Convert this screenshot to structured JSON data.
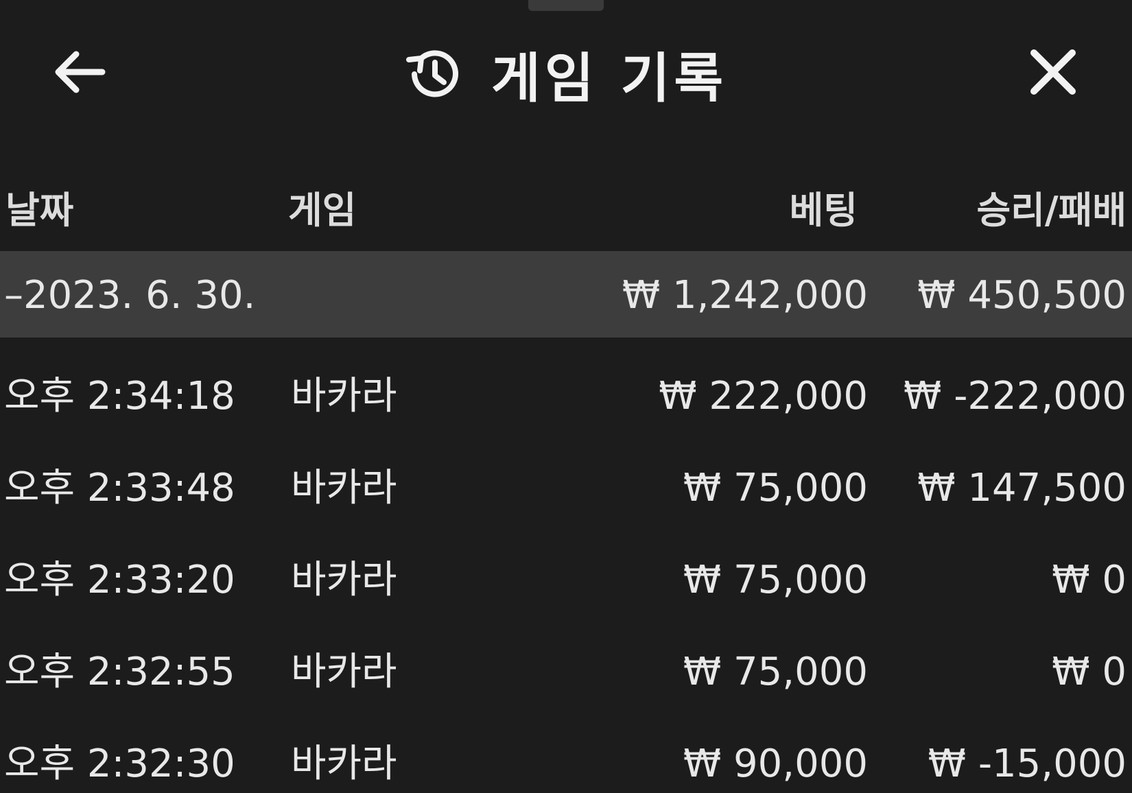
{
  "header": {
    "title": "게임 기록",
    "back_icon": "arrow-left-icon",
    "history_icon": "history-clock-icon",
    "close_icon": "close-icon"
  },
  "columns": {
    "date": "날짜",
    "game": "게임",
    "bet": "베팅",
    "result": "승리/패배"
  },
  "summary": {
    "date": "–2023. 6. 30.",
    "bet": "₩ 1,242,000",
    "result": "₩ 450,500"
  },
  "rows": [
    {
      "time": "오후 2:34:18",
      "game": "바카라",
      "bet": "₩ 222,000",
      "result": "₩ -222,000"
    },
    {
      "time": "오후 2:33:48",
      "game": "바카라",
      "bet": "₩ 75,000",
      "result": "₩ 147,500"
    },
    {
      "time": "오후 2:33:20",
      "game": "바카라",
      "bet": "₩ 75,000",
      "result": "₩ 0"
    },
    {
      "time": "오후 2:32:55",
      "game": "바카라",
      "bet": "₩ 75,000",
      "result": "₩ 0"
    },
    {
      "time": "오후 2:32:30",
      "game": "바카라",
      "bet": "₩ 90,000",
      "result": "₩ -15,000"
    }
  ],
  "colors": {
    "background": "#1c1c1c",
    "summary_row": "#3d3d3d",
    "text": "#e8e8e8"
  }
}
